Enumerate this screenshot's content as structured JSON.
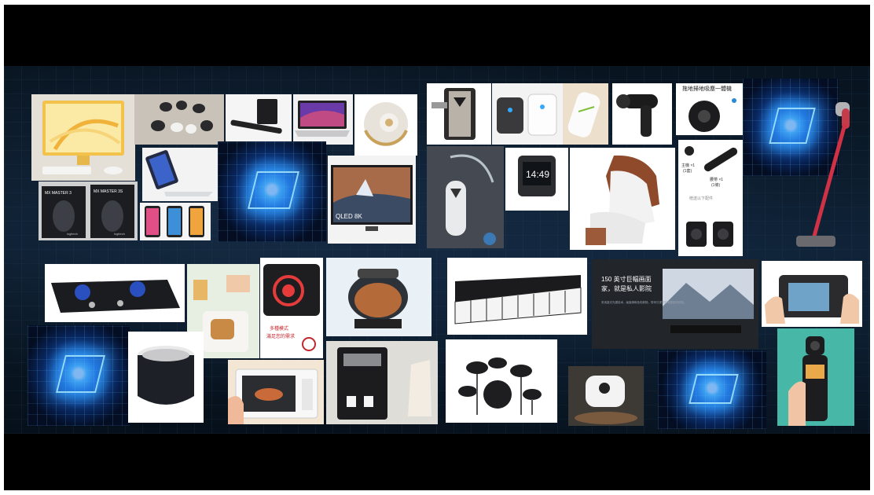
{
  "products": {
    "mouse_box_1": "MX MASTER 3",
    "mouse_box_2": "MX MASTER 3S",
    "mouse_brand_1": "logitech",
    "mouse_brand_2": "logitech",
    "tv_badge": "QLED 8K",
    "watch_display": "14:49",
    "robot_vacuum_caption": "拖地掃地吸塵一體機",
    "massager_label_1": "主機 ×1",
    "massager_label_2": "(1套)",
    "massager_label_3": "腰帶 ×1",
    "massager_label_4": "(1條)",
    "massager_caption": "贈送以下配件",
    "cooker_caption_line1": "多種模式",
    "cooker_caption_line2": "滿足您的需求",
    "projector_title_line1": "150 英寸巨幅画面",
    "projector_title_line2": "家，就是私人影院",
    "projector_body": "采用激光光源技术，画面清晰色彩鲜艳，带来沉浸式的家庭影院体验。"
  },
  "colors": {
    "frame_bg": "#000000",
    "band_bg": "#0b1b2a",
    "chip_glow": "#58c8ff"
  }
}
